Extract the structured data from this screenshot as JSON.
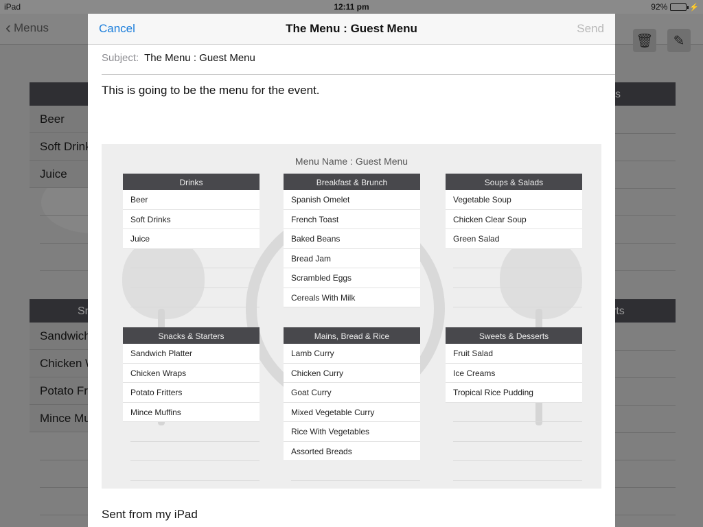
{
  "status_bar": {
    "device": "iPad",
    "time": "12:11 pm",
    "battery": "92%",
    "battery_level": 0.92
  },
  "background_app": {
    "back_label": "Menus",
    "left_top_items": [
      "Beer",
      "Soft Drink",
      "Juice"
    ],
    "left_bottom_header": "Sn",
    "left_bottom_items": [
      "Sandwich",
      "Chicken W",
      "Potato Fr",
      "Mince Mu"
    ],
    "right_top_header": "s",
    "right_bottom_header": "rts"
  },
  "compose": {
    "cancel_label": "Cancel",
    "title": "The Menu : Guest Menu",
    "send_label": "Send",
    "subject_label": "Subject:",
    "subject_value": "The Menu : Guest Menu",
    "body": "This is going to be the menu for the event.",
    "signature": "Sent from my iPad"
  },
  "menu": {
    "name": "Menu Name : Guest Menu",
    "sections": [
      {
        "title": "Drinks",
        "items": [
          "Beer",
          "Soft Drinks",
          "Juice"
        ]
      },
      {
        "title": "Breakfast & Brunch",
        "items": [
          "Spanish Omelet",
          "French Toast",
          "Baked Beans",
          "Bread Jam",
          "Scrambled Eggs",
          "Cereals With Milk"
        ]
      },
      {
        "title": "Soups & Salads",
        "items": [
          "Vegetable Soup",
          "Chicken Clear Soup",
          "Green Salad"
        ]
      },
      {
        "title": "Snacks & Starters",
        "items": [
          "Sandwich Platter",
          "Chicken Wraps",
          "Potato Fritters",
          "Mince Muffins"
        ]
      },
      {
        "title": "Mains, Bread & Rice",
        "items": [
          "Lamb Curry",
          "Chicken Curry",
          "Goat Curry",
          "Mixed Vegetable Curry",
          "Rice With Vegetables",
          "Assorted Breads"
        ]
      },
      {
        "title": "Sweets & Desserts",
        "items": [
          "Fruit Salad",
          "Ice Creams",
          "Tropical Rice Pudding"
        ]
      }
    ]
  }
}
